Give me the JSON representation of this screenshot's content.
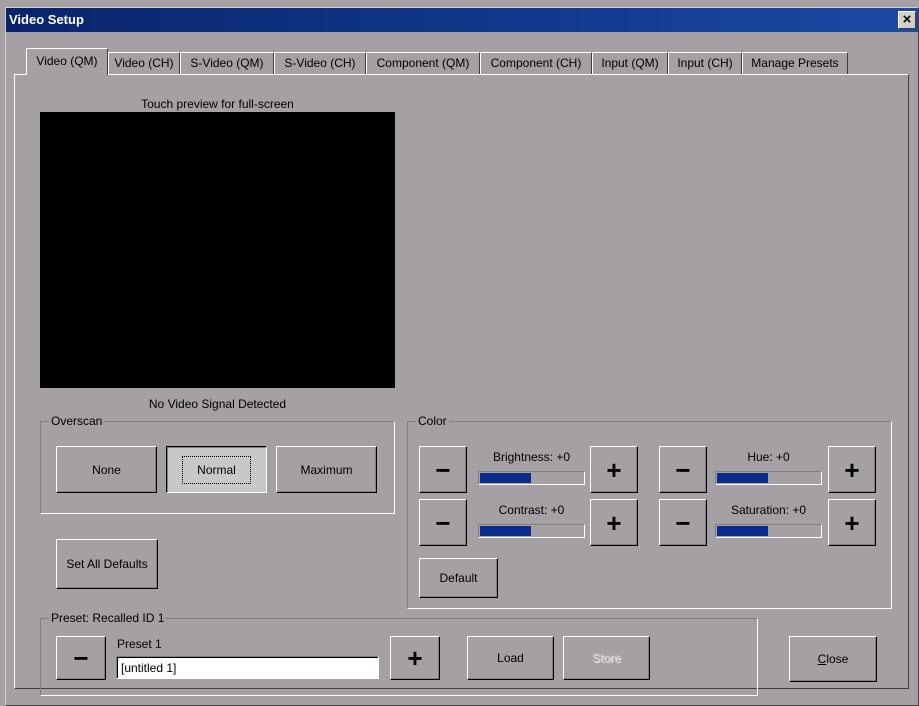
{
  "window": {
    "title": "Video Setup",
    "close_glyph": "×"
  },
  "tabs": [
    {
      "label": "Video (QM)",
      "active": true
    },
    {
      "label": "Video (CH)",
      "active": false
    },
    {
      "label": "S-Video (QM)",
      "active": false
    },
    {
      "label": "S-Video (CH)",
      "active": false
    },
    {
      "label": "Component (QM)",
      "active": false
    },
    {
      "label": "Component (CH)",
      "active": false
    },
    {
      "label": "Input (QM)",
      "active": false
    },
    {
      "label": "Input (CH)",
      "active": false
    },
    {
      "label": "Manage Presets",
      "active": false
    }
  ],
  "preview": {
    "hint": "Touch preview for full-screen",
    "status": "No Video Signal Detected"
  },
  "overscan": {
    "title": "Overscan",
    "options": [
      "None",
      "Normal",
      "Maximum"
    ],
    "selected": "Normal"
  },
  "color": {
    "title": "Color",
    "brightness": {
      "label": "Brightness: +0",
      "level": 0.5
    },
    "contrast": {
      "label": "Contrast: +0",
      "level": 0.5
    },
    "hue": {
      "label": "Hue: +0",
      "level": 0.5
    },
    "saturation": {
      "label": "Saturation: +0",
      "level": 0.5
    },
    "minus": "−",
    "plus": "+",
    "default_label": "Default"
  },
  "set_all_defaults_label": "Set All Defaults",
  "preset": {
    "title": "Preset: Recalled ID 1",
    "name_label": "Preset 1",
    "name_value": "[untitled 1]",
    "minus": "−",
    "plus": "+",
    "load_label": "Load",
    "store_label": "Store"
  },
  "close_label_rest": "lose",
  "close_label_accel": "C",
  "colors": {
    "titlebar": "#0a246a",
    "face": "#a4a0a4",
    "bar_fill": "#0b2c8a"
  }
}
